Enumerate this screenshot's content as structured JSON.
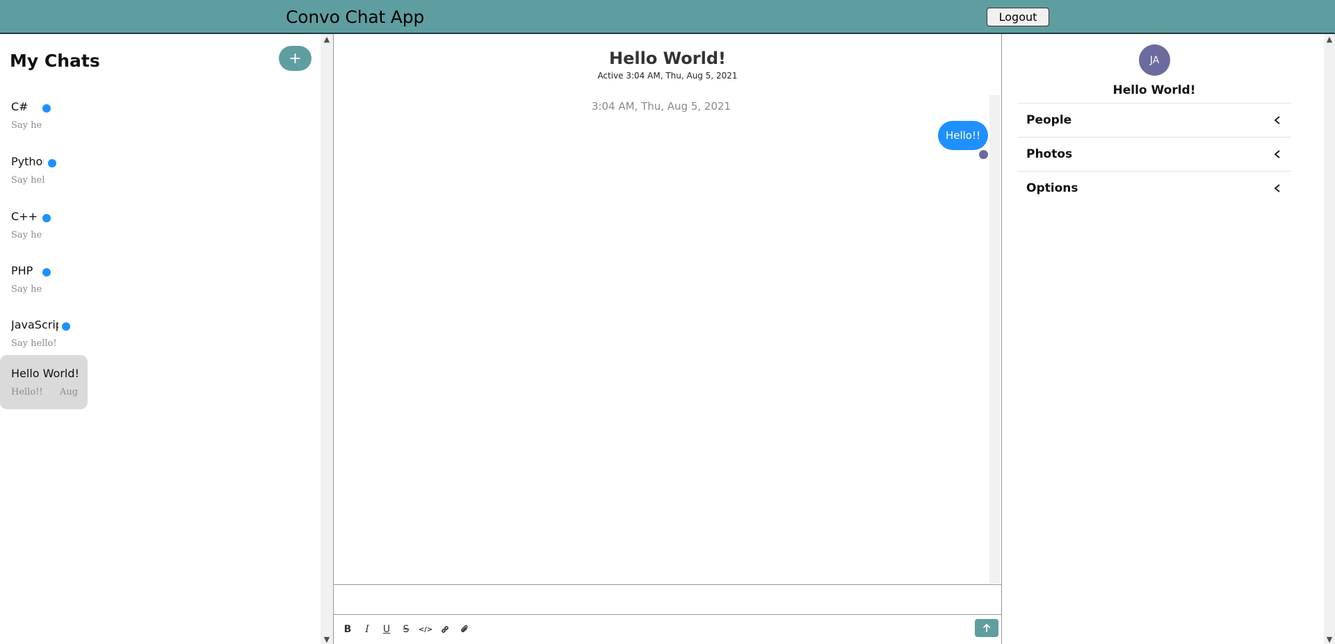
{
  "header": {
    "app_title": "Convo Chat App",
    "logout_label": "Logout",
    "bg_color": "#5f9ea0"
  },
  "sidebar": {
    "title": "My Chats",
    "add_label": "+",
    "chats": [
      {
        "name": "C#",
        "preview": "Say hel",
        "unread": true
      },
      {
        "name": "Pythor",
        "preview": "Say hello",
        "unread": true
      },
      {
        "name": "C++",
        "preview": "Say hel",
        "unread": true
      },
      {
        "name": "PHP",
        "preview": "Say hel",
        "unread": true
      },
      {
        "name": "JavaScrip",
        "preview": "Say hello!",
        "unread": true
      },
      {
        "name": "Hello World!",
        "preview": "Hello!!",
        "date": "Aug",
        "selected": true
      }
    ]
  },
  "chat": {
    "title": "Hello World!",
    "active_status": "Active 3:04 AM, Thu, Aug 5, 2021",
    "messages": [
      {
        "timestamp": "3:04 AM, Thu, Aug 5, 2021",
        "text": "Hello!!",
        "outgoing": true
      }
    ],
    "composer_placeholder": "",
    "toolbar": {
      "bold": "B",
      "italic": "I",
      "underline": "U",
      "strike": "S",
      "code": "</>"
    },
    "bubble_color": "#1e90ff"
  },
  "details": {
    "avatar_initials": "JA",
    "name": "Hello World!",
    "sections": [
      {
        "label": "People"
      },
      {
        "label": "Photos"
      },
      {
        "label": "Options"
      }
    ],
    "avatar_color": "#6b6b9f"
  }
}
